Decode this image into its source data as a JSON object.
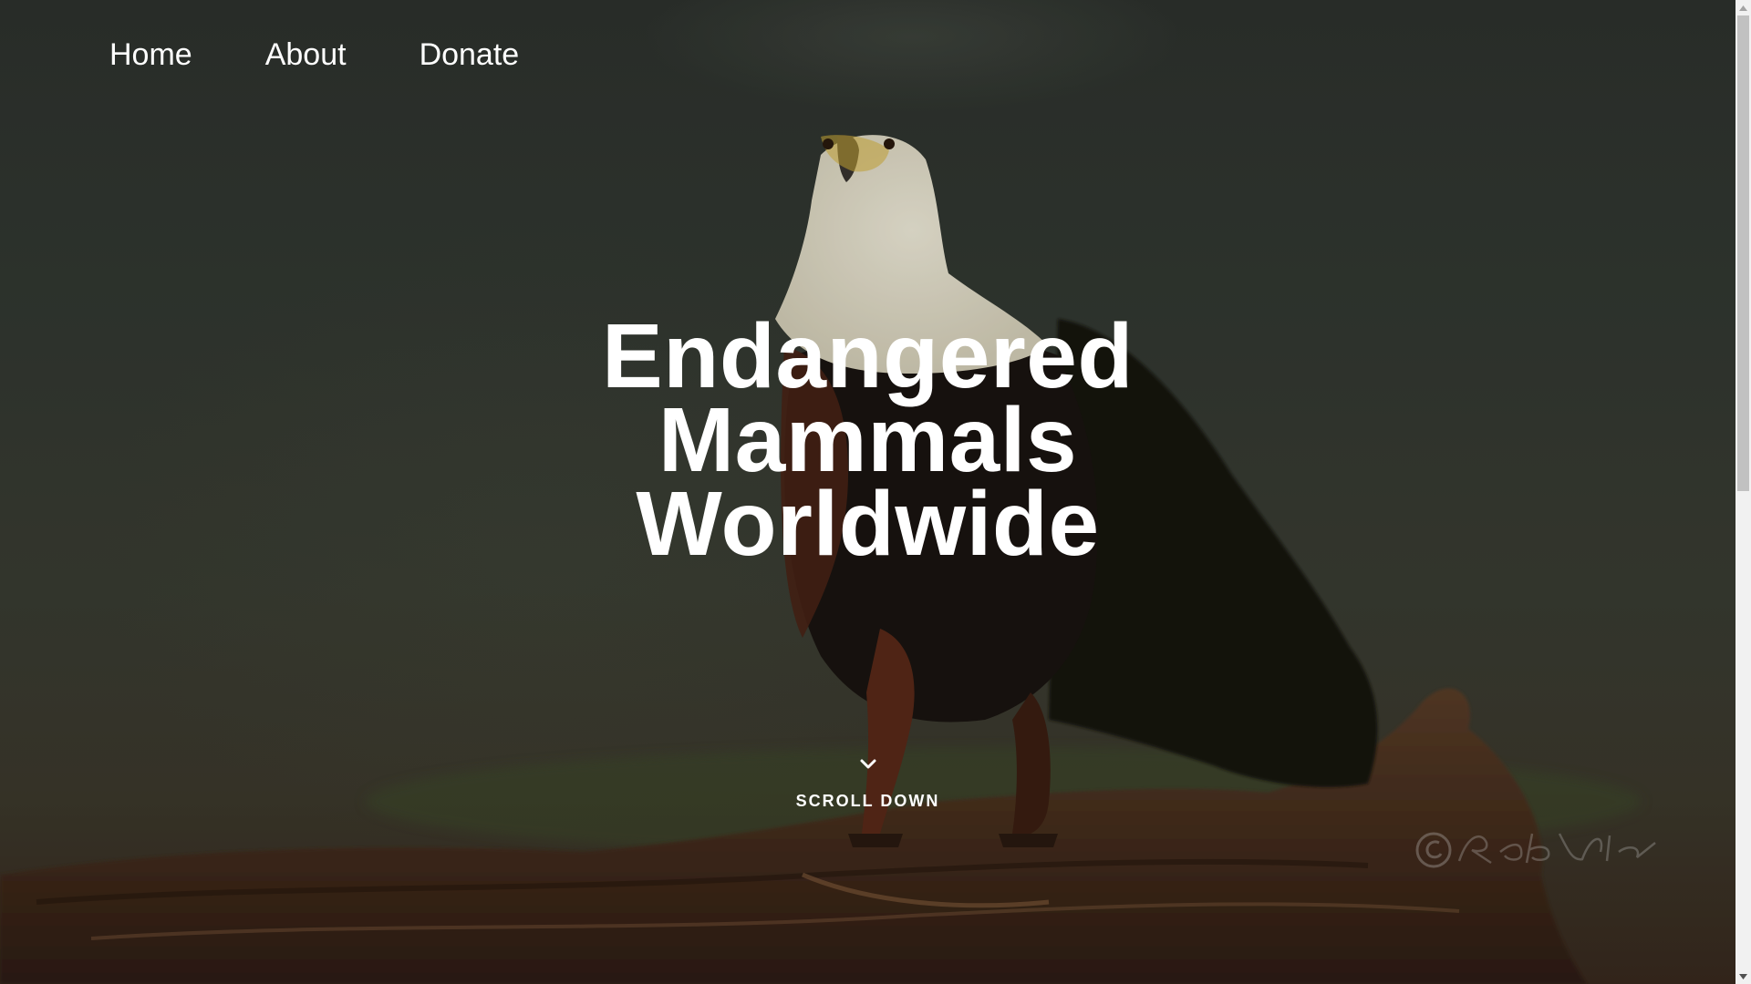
{
  "nav": {
    "items": [
      {
        "label": "Home"
      },
      {
        "label": "About"
      },
      {
        "label": "Donate"
      }
    ]
  },
  "hero": {
    "title_lines": [
      "Endangered",
      "Mammals",
      "Worldwide"
    ],
    "scroll_label": "SCROLL DOWN",
    "scroll_icon": "chevron-down-icon",
    "watermark": "©RobertHolder"
  },
  "scrollbar": {
    "position_fraction": 0.0,
    "visible_fraction": 0.49
  },
  "colors": {
    "text": "#ffffff",
    "background_dark": "#2e332e",
    "log_brown": "#4a3222",
    "eagle_white": "#eee9d6",
    "eagle_chestnut": "#4a2416",
    "eagle_black": "#141210",
    "scrollbar_track": "#f1f1f1",
    "scrollbar_thumb": "#c1c1c1"
  }
}
